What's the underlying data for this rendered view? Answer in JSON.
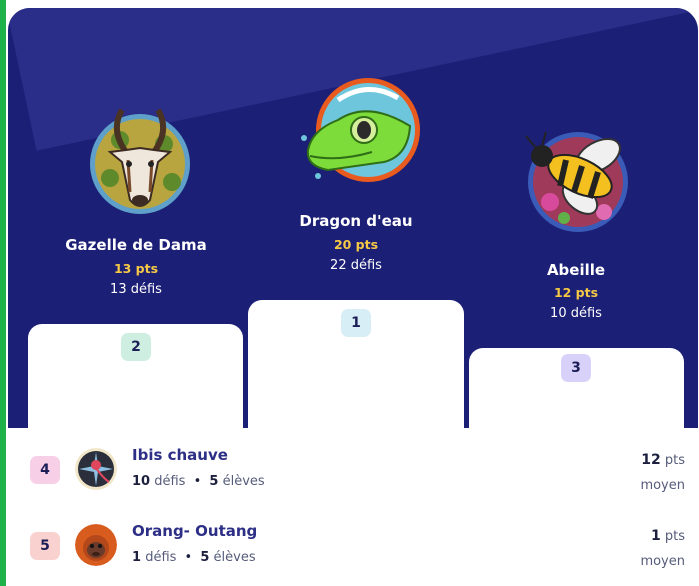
{
  "podium": [
    {
      "rank": "1",
      "name": "Dragon d'eau",
      "points": "20 pts",
      "defis": "22 défis",
      "avatar_icon": "water-dragon-icon",
      "chip_color": "#d8eef6"
    },
    {
      "rank": "2",
      "name": "Gazelle de Dama",
      "points": "13 pts",
      "defis": "13 défis",
      "avatar_icon": "gazelle-icon",
      "chip_color": "#cdeee0"
    },
    {
      "rank": "3",
      "name": "Abeille",
      "points": "12 pts",
      "defis": "10 défis",
      "avatar_icon": "bee-icon",
      "chip_color": "#d8d2fb"
    }
  ],
  "ranking": [
    {
      "rank": "4",
      "name": "Ibis chauve",
      "defis_count": "10",
      "defis_label": "défis",
      "separator": "•",
      "eleves_count": "5",
      "eleves_label": "élèves",
      "points_value": "12",
      "points_unit": "pts",
      "level": "moyen",
      "chip_color": "#f7cfe6",
      "avatar_icon": "ibis-icon"
    },
    {
      "rank": "5",
      "name": "Orang- Outang",
      "defis_count": "1",
      "defis_label": "défis",
      "separator": "•",
      "eleves_count": "5",
      "eleves_label": "élèves",
      "points_value": "1",
      "points_unit": "pts",
      "level": "moyen",
      "chip_color": "#f9d2cf",
      "avatar_icon": "orangutan-icon"
    }
  ],
  "colors": {
    "podium_background": "#1c1f76",
    "points_accent": "#f6c944",
    "frame_accent": "#1fb14a"
  }
}
